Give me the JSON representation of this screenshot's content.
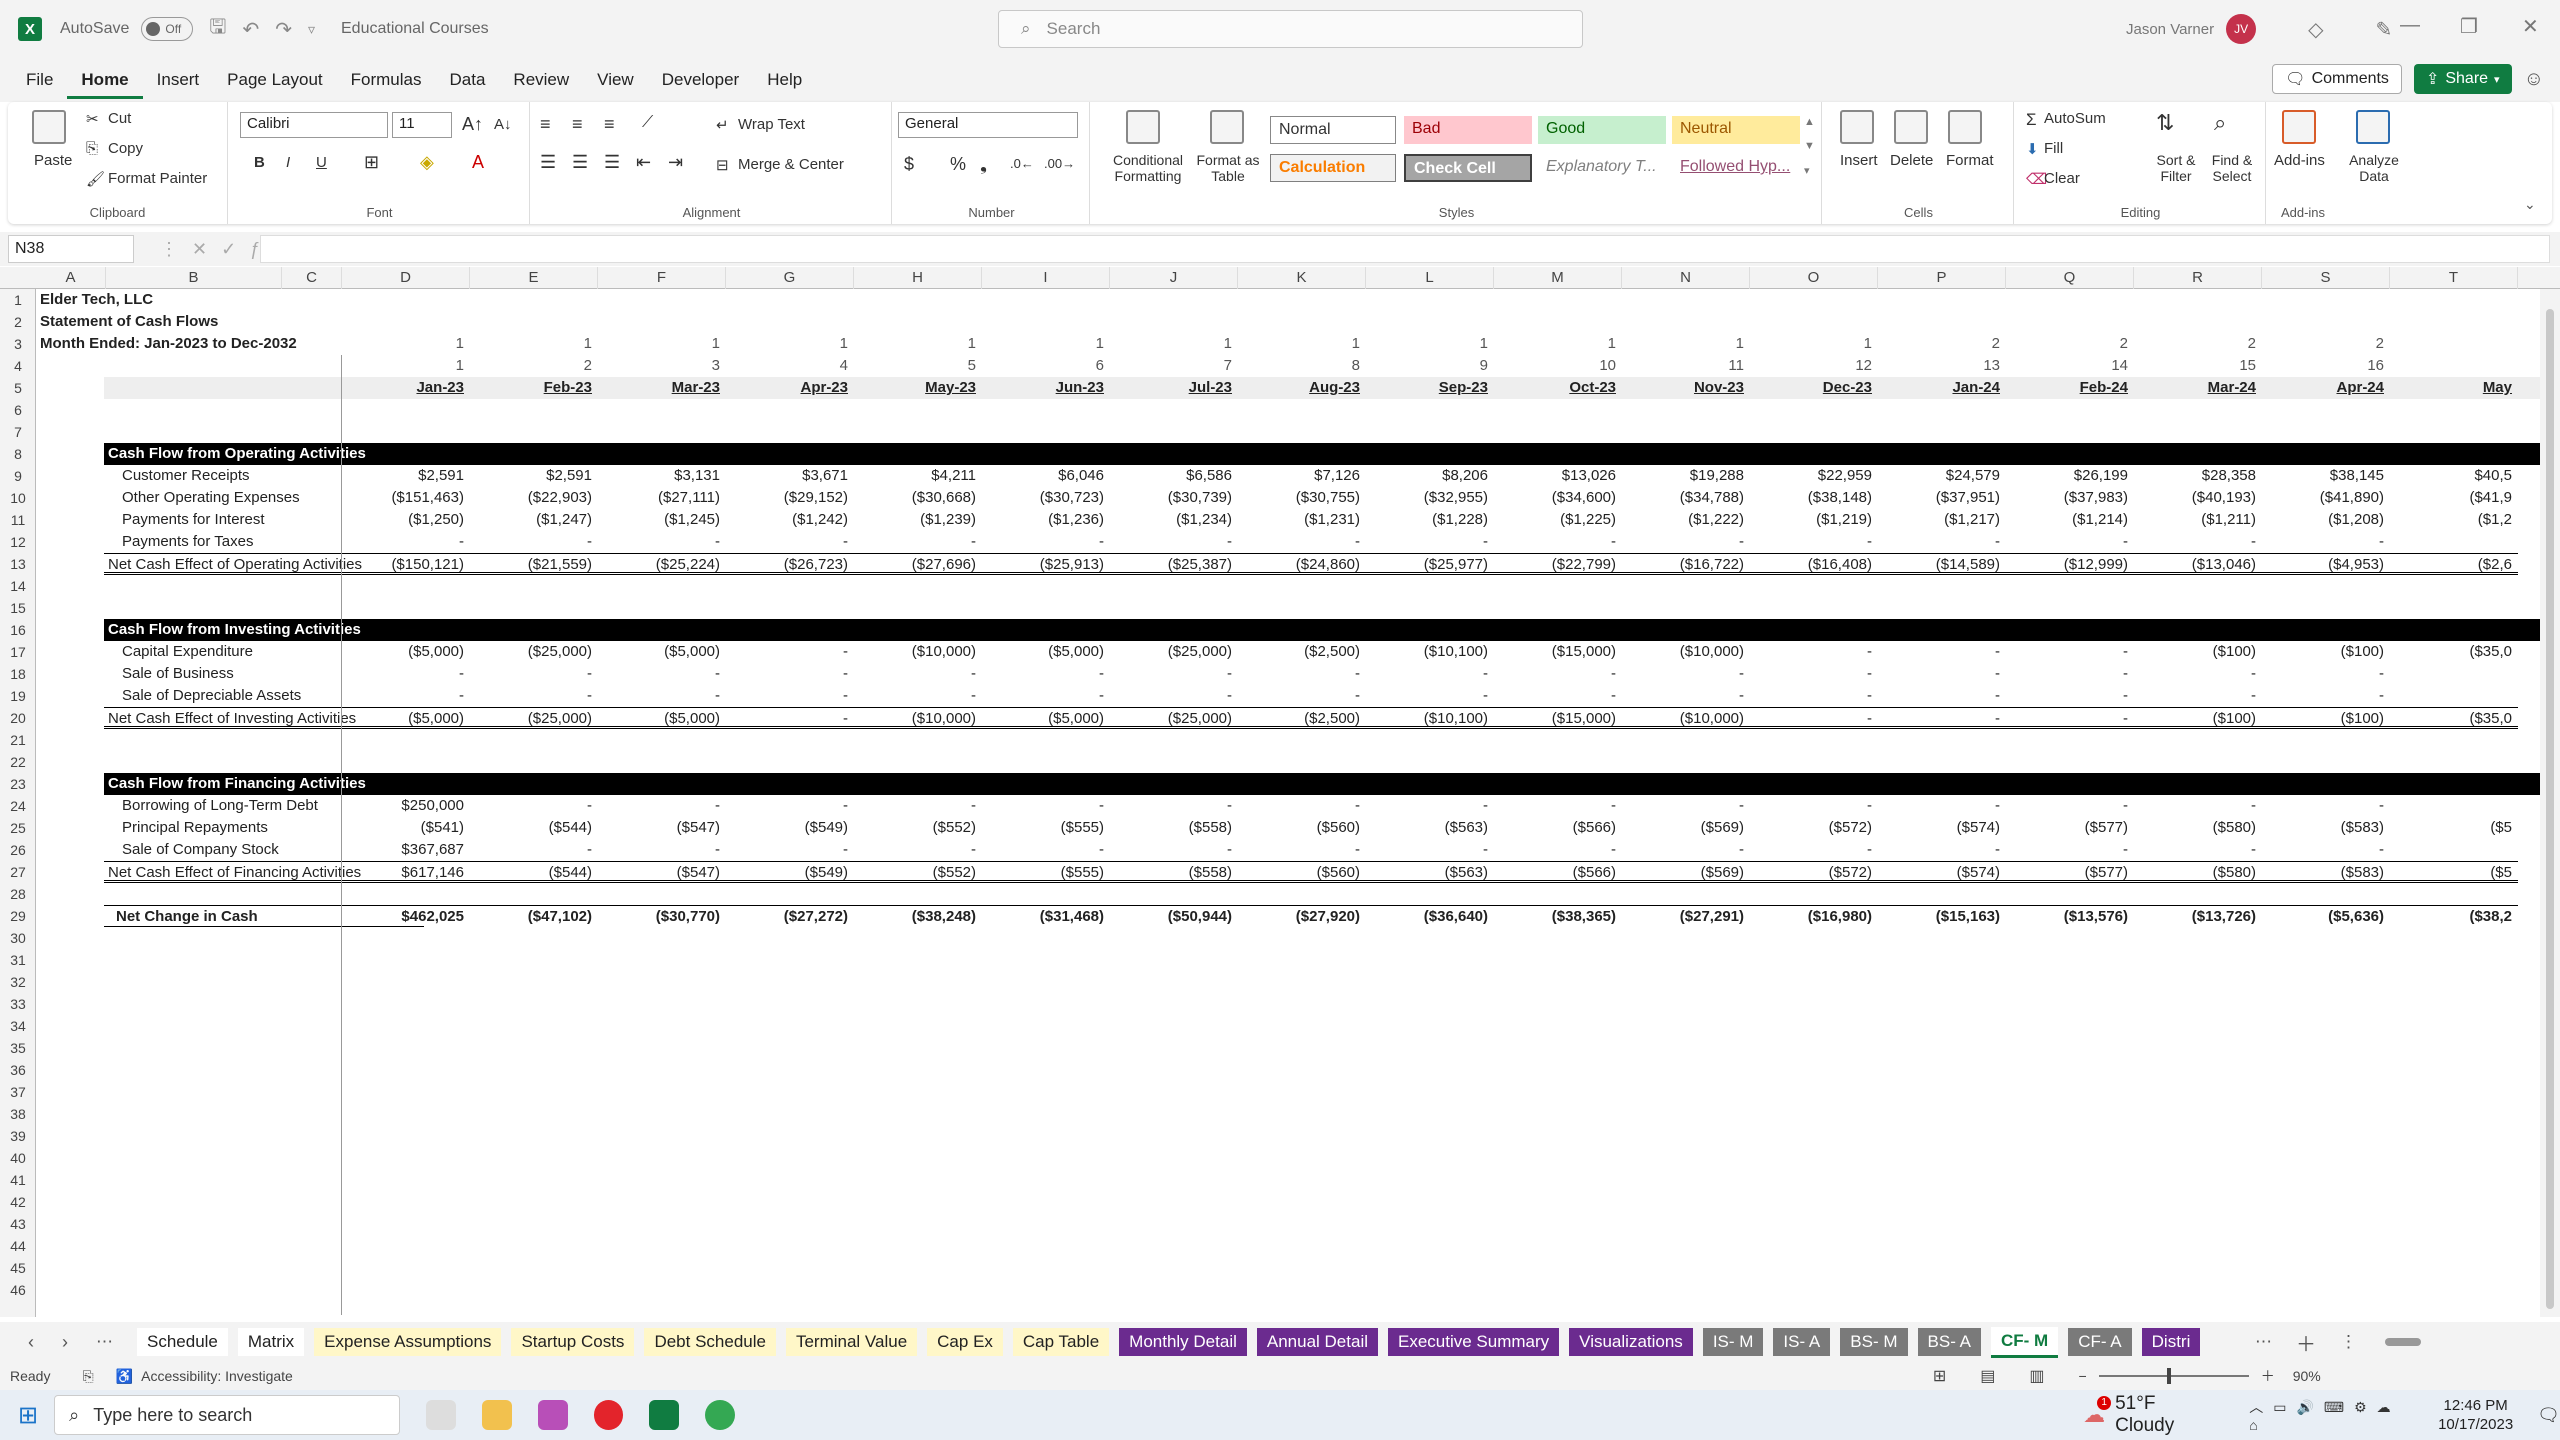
{
  "app": {
    "autosave_label": "AutoSave",
    "autosave_state": "Off",
    "file_name": "Educational Courses",
    "search_placeholder": "Search",
    "user_name": "Jason Varner",
    "user_initials": "JV"
  },
  "menu": [
    "File",
    "Home",
    "Insert",
    "Page Layout",
    "Formulas",
    "Data",
    "Review",
    "View",
    "Developer",
    "Help"
  ],
  "menu_right": {
    "comments": "Comments",
    "share": "Share"
  },
  "ribbon": {
    "clipboard": {
      "label": "Clipboard",
      "paste": "Paste",
      "cut": "Cut",
      "copy": "Copy",
      "format_painter": "Format Painter"
    },
    "font": {
      "label": "Font",
      "family": "Calibri",
      "size": "11"
    },
    "alignment": {
      "label": "Alignment",
      "wrap": "Wrap Text",
      "merge": "Merge & Center"
    },
    "number": {
      "label": "Number",
      "format": "General"
    },
    "styles": {
      "label": "Styles",
      "conditional": "Conditional Formatting",
      "format_table": "Format as Table",
      "normal": "Normal",
      "bad": "Bad",
      "good": "Good",
      "neutral": "Neutral",
      "calculation": "Calculation",
      "check_cell": "Check Cell",
      "explanatory": "Explanatory T...",
      "followed": "Followed Hyp..."
    },
    "cells": {
      "label": "Cells",
      "insert": "Insert",
      "delete": "Delete",
      "format": "Format"
    },
    "editing": {
      "label": "Editing",
      "autosum": "AutoSum",
      "fill": "Fill",
      "clear": "Clear",
      "sort": "Sort & Filter",
      "find": "Find & Select"
    },
    "addins": {
      "label": "Add-ins",
      "addins": "Add-ins",
      "analyze": "Analyze Data"
    }
  },
  "namebox": "N38",
  "columns": [
    "A",
    "B",
    "C",
    "D",
    "E",
    "F",
    "G",
    "H",
    "I",
    "J",
    "K",
    "L",
    "M",
    "N",
    "O",
    "P",
    "Q",
    "R",
    "S",
    "T"
  ],
  "rows_count": 46,
  "sheet": {
    "title1": "Elder Tech, LLC",
    "title2": "Statement of Cash Flows",
    "title3": "Month Ended: Jan-2023 to Dec-2032",
    "row3": [
      "1",
      "1",
      "1",
      "1",
      "1",
      "1",
      "1",
      "1",
      "1",
      "1",
      "1",
      "1",
      "2",
      "2",
      "2",
      "2"
    ],
    "row4": [
      "1",
      "2",
      "3",
      "4",
      "5",
      "6",
      "7",
      "8",
      "9",
      "10",
      "11",
      "12",
      "13",
      "14",
      "15",
      "16"
    ],
    "months": [
      "Jan-23",
      "Feb-23",
      "Mar-23",
      "Apr-23",
      "May-23",
      "Jun-23",
      "Jul-23",
      "Aug-23",
      "Sep-23",
      "Oct-23",
      "Nov-23",
      "Dec-23",
      "Jan-24",
      "Feb-24",
      "Mar-24",
      "Apr-24",
      "May"
    ],
    "operating": {
      "header": "Cash Flow from Operating Activities",
      "lines": [
        {
          "label": "Customer Receipts",
          "values": [
            "$2,591",
            "$2,591",
            "$3,131",
            "$3,671",
            "$4,211",
            "$6,046",
            "$6,586",
            "$7,126",
            "$8,206",
            "$13,026",
            "$19,288",
            "$22,959",
            "$24,579",
            "$26,199",
            "$28,358",
            "$38,145",
            "$40,5"
          ]
        },
        {
          "label": "Other Operating Expenses",
          "values": [
            "($151,463)",
            "($22,903)",
            "($27,111)",
            "($29,152)",
            "($30,668)",
            "($30,723)",
            "($30,739)",
            "($30,755)",
            "($32,955)",
            "($34,600)",
            "($34,788)",
            "($38,148)",
            "($37,951)",
            "($37,983)",
            "($40,193)",
            "($41,890)",
            "($41,9"
          ]
        },
        {
          "label": "Payments for Interest",
          "values": [
            "($1,250)",
            "($1,247)",
            "($1,245)",
            "($1,242)",
            "($1,239)",
            "($1,236)",
            "($1,234)",
            "($1,231)",
            "($1,228)",
            "($1,225)",
            "($1,222)",
            "($1,219)",
            "($1,217)",
            "($1,214)",
            "($1,211)",
            "($1,208)",
            "($1,2"
          ]
        },
        {
          "label": "Payments for Taxes",
          "values": [
            "-",
            "-",
            "-",
            "-",
            "-",
            "-",
            "-",
            "-",
            "-",
            "-",
            "-",
            "-",
            "-",
            "-",
            "-",
            "-",
            ""
          ]
        }
      ],
      "total": {
        "label": "Net Cash Effect of Operating Activities",
        "values": [
          "($150,121)",
          "($21,559)",
          "($25,224)",
          "($26,723)",
          "($27,696)",
          "($25,913)",
          "($25,387)",
          "($24,860)",
          "($25,977)",
          "($22,799)",
          "($16,722)",
          "($16,408)",
          "($14,589)",
          "($12,999)",
          "($13,046)",
          "($4,953)",
          "($2,6"
        ]
      }
    },
    "investing": {
      "header": "Cash Flow from Investing Activities",
      "lines": [
        {
          "label": "Capital Expenditure",
          "values": [
            "($5,000)",
            "($25,000)",
            "($5,000)",
            "-",
            "($10,000)",
            "($5,000)",
            "($25,000)",
            "($2,500)",
            "($10,100)",
            "($15,000)",
            "($10,000)",
            "-",
            "-",
            "-",
            "($100)",
            "($100)",
            "($35,0"
          ]
        },
        {
          "label": "Sale of Business",
          "values": [
            "-",
            "-",
            "-",
            "-",
            "-",
            "-",
            "-",
            "-",
            "-",
            "-",
            "-",
            "-",
            "-",
            "-",
            "-",
            "-",
            ""
          ]
        },
        {
          "label": "Sale of Depreciable Assets",
          "values": [
            "-",
            "-",
            "-",
            "-",
            "-",
            "-",
            "-",
            "-",
            "-",
            "-",
            "-",
            "-",
            "-",
            "-",
            "-",
            "-",
            ""
          ]
        }
      ],
      "total": {
        "label": "Net Cash Effect of Investing Activities",
        "values": [
          "($5,000)",
          "($25,000)",
          "($5,000)",
          "-",
          "($10,000)",
          "($5,000)",
          "($25,000)",
          "($2,500)",
          "($10,100)",
          "($15,000)",
          "($10,000)",
          "-",
          "-",
          "-",
          "($100)",
          "($100)",
          "($35,0"
        ]
      }
    },
    "financing": {
      "header": "Cash Flow from Financing Activities",
      "lines": [
        {
          "label": "Borrowing of Long-Term Debt",
          "values": [
            "$250,000",
            "-",
            "-",
            "-",
            "-",
            "-",
            "-",
            "-",
            "-",
            "-",
            "-",
            "-",
            "-",
            "-",
            "-",
            "-",
            ""
          ]
        },
        {
          "label": "Principal Repayments",
          "values": [
            "($541)",
            "($544)",
            "($547)",
            "($549)",
            "($552)",
            "($555)",
            "($558)",
            "($560)",
            "($563)",
            "($566)",
            "($569)",
            "($572)",
            "($574)",
            "($577)",
            "($580)",
            "($583)",
            "($5"
          ]
        },
        {
          "label": "Sale of Company Stock",
          "values": [
            "$367,687",
            "-",
            "-",
            "-",
            "-",
            "-",
            "-",
            "-",
            "-",
            "-",
            "-",
            "-",
            "-",
            "-",
            "-",
            "-",
            ""
          ]
        }
      ],
      "total": {
        "label": "Net Cash Effect of Financing Activities",
        "values": [
          "$617,146",
          "($544)",
          "($547)",
          "($549)",
          "($552)",
          "($555)",
          "($558)",
          "($560)",
          "($563)",
          "($566)",
          "($569)",
          "($572)",
          "($574)",
          "($577)",
          "($580)",
          "($583)",
          "($5"
        ]
      }
    },
    "net_change": {
      "label": "Net Change in Cash",
      "values": [
        "$462,025",
        "($47,102)",
        "($30,770)",
        "($27,272)",
        "($38,248)",
        "($31,468)",
        "($50,944)",
        "($27,920)",
        "($36,640)",
        "($38,365)",
        "($27,291)",
        "($16,980)",
        "($15,163)",
        "($13,576)",
        "($13,726)",
        "($5,636)",
        "($38,2"
      ]
    }
  },
  "tabs": [
    {
      "name": "Schedule",
      "style": "white"
    },
    {
      "name": "Matrix",
      "style": "white"
    },
    {
      "name": "Expense Assumptions",
      "style": "yellow"
    },
    {
      "name": "Startup Costs",
      "style": "yellow"
    },
    {
      "name": "Debt Schedule",
      "style": "yellow"
    },
    {
      "name": "Terminal Value",
      "style": "yellow"
    },
    {
      "name": "Cap Ex",
      "style": "yellow"
    },
    {
      "name": "Cap Table",
      "style": "yellow"
    },
    {
      "name": "Monthly Detail",
      "style": "purple"
    },
    {
      "name": "Annual Detail",
      "style": "purple"
    },
    {
      "name": "Executive Summary",
      "style": "purple"
    },
    {
      "name": "Visualizations",
      "style": "purple"
    },
    {
      "name": "IS- M",
      "style": "gray"
    },
    {
      "name": "IS- A",
      "style": "gray"
    },
    {
      "name": "BS- M",
      "style": "gray"
    },
    {
      "name": "BS- A",
      "style": "gray"
    },
    {
      "name": "CF- M",
      "style": "active"
    },
    {
      "name": "CF- A",
      "style": "gray"
    },
    {
      "name": "Distri",
      "style": "purple"
    }
  ],
  "status": {
    "ready": "Ready",
    "accessibility": "Accessibility: Investigate",
    "zoom": "90%"
  },
  "taskbar": {
    "search_placeholder": "Type here to search",
    "weather": "51°F  Cloudy",
    "time": "12:46 PM",
    "date": "10/17/2023",
    "badge": "1"
  },
  "colors": {
    "excel_green": "#107c41",
    "header_black": "#000000",
    "tab_purple": "#6b2b8f",
    "tab_yellow": "#fff7c8"
  }
}
